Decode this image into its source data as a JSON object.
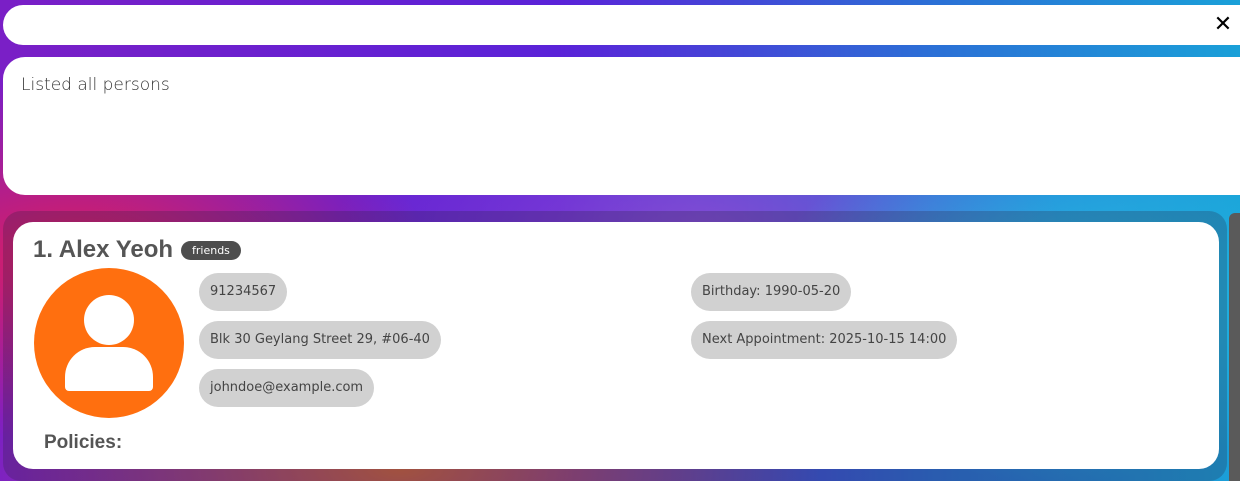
{
  "command": {
    "value": "",
    "clear_glyph": "✕"
  },
  "result": {
    "message": "Listed all persons"
  },
  "person": {
    "index_name": "1. Alex Yeoh",
    "tags": [
      "friends"
    ],
    "phone": "91234567",
    "address": "Blk 30 Geylang Street 29, #06-40",
    "email": "johndoe@example.com",
    "birthday": "Birthday: 1990-05-20",
    "appointment": "Next Appointment: 2025-10-15 14:00",
    "policies_label": "Policies:",
    "avatar_color": "#ff6f0f"
  },
  "colors": {
    "tag_bg": "#4e4e4e",
    "pill_bg": "#d1d1d1"
  }
}
